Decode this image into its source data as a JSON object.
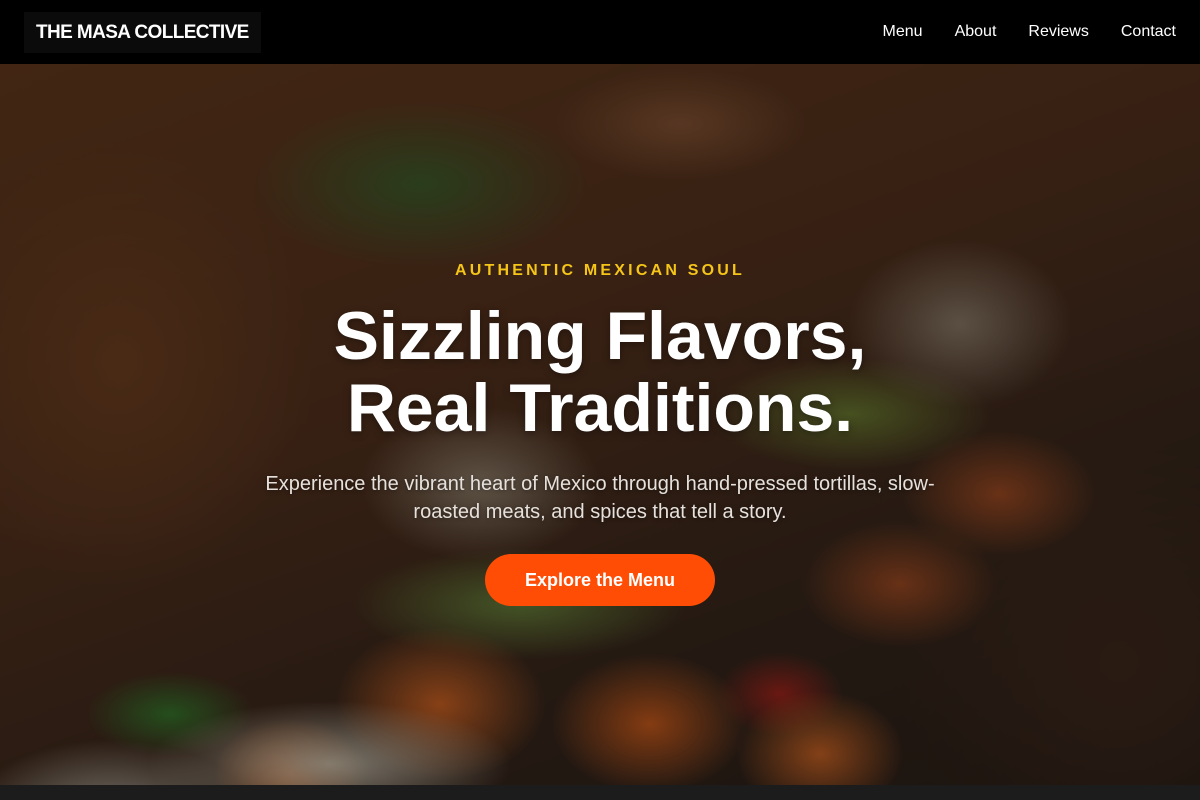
{
  "header": {
    "logo": "THE MASA COLLECTIVE",
    "nav": [
      {
        "label": "Menu"
      },
      {
        "label": "About"
      },
      {
        "label": "Reviews"
      },
      {
        "label": "Contact"
      }
    ]
  },
  "hero": {
    "eyebrow": "AUTHENTIC MEXICAN SOUL",
    "headline_line1": "Sizzling Flavors,",
    "headline_line2": "Real Traditions.",
    "subtext": "Experience the vibrant heart of Mexico through hand-pressed tortillas, slow-roasted meats, and spices that tell a story.",
    "cta_label": "Explore the Menu",
    "background_image": "tacos-photo"
  },
  "colors": {
    "header_bg": "#000000",
    "eyebrow": "#f5c518",
    "cta": "#ff4d05"
  }
}
